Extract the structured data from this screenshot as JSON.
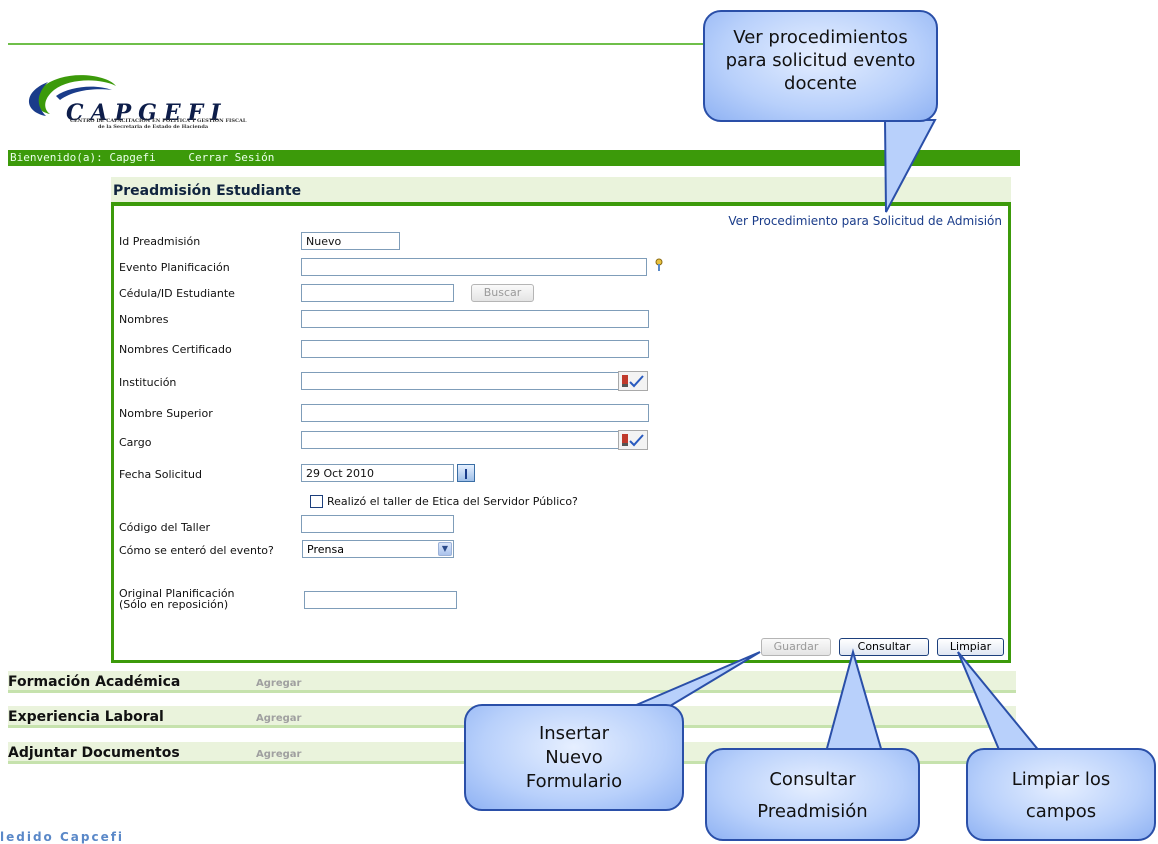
{
  "logo": {
    "brand": "CAPGEFI",
    "line1": "CENTRO DE CAPACITACION EN POLITICA Y GESTION FISCAL",
    "line2": "de la Secretaria de Estado de Hacienda"
  },
  "userbar": {
    "welcome": "Bienvenido(a): Capgefi",
    "logout": "Cerrar Sesión"
  },
  "panel": {
    "title": "Preadmisión Estudiante",
    "procedure_link": "Ver Procedimiento para Solicitud de Admisión"
  },
  "form": {
    "id_label": "Id Preadmisión",
    "id_value": "Nuevo",
    "event_label": "Evento Planificación",
    "event_value": "",
    "cedula_label": "Cédula/ID Estudiante",
    "cedula_value": "",
    "buscar": "Buscar",
    "nombres_label": "Nombres",
    "nombres_value": "",
    "nombres_cert_label": "Nombres Certificado",
    "nombres_cert_value": "",
    "institucion_label": "Institución",
    "institucion_value": "",
    "superior_label": "Nombre Superior",
    "superior_value": "",
    "cargo_label": "Cargo",
    "cargo_value": "",
    "fecha_label": "Fecha Solicitud",
    "fecha_value": "29 Oct 2010",
    "taller_check": "Realizó el taller de Etica del Servidor Público?",
    "codigo_label": "Código del Taller",
    "codigo_value": "",
    "como_label": "Cómo se enteró del evento?",
    "como_value": "Prensa",
    "original_label1": "Original Planificación",
    "original_label2": "(Sólo en reposición)",
    "original_value": ""
  },
  "buttons": {
    "guardar": "Guardar",
    "consultar": "Consultar",
    "limpiar": "Limpiar"
  },
  "sections": [
    {
      "title": "Formación Académica",
      "add": "Agregar"
    },
    {
      "title": "Experiencia Laboral",
      "add": "Agregar"
    },
    {
      "title": "Adjuntar Documentos",
      "add": "Agregar"
    }
  ],
  "footer": "ledido Capcefi",
  "callouts": {
    "procedures": [
      "Ver procedimientos",
      "para solicitud evento",
      "docente"
    ],
    "insert": [
      "Insertar",
      "Nuevo",
      "Formulario"
    ],
    "consult": [
      "Consultar",
      "Preadmisión"
    ],
    "clear": [
      "Limpiar los",
      "campos"
    ]
  },
  "colors": {
    "green": "#3c9a0a",
    "section_bg": "#eaf3dc",
    "callout_fill": "#b8d0fb",
    "callout_border": "#2a4fa8",
    "link": "#1a3c8a"
  }
}
